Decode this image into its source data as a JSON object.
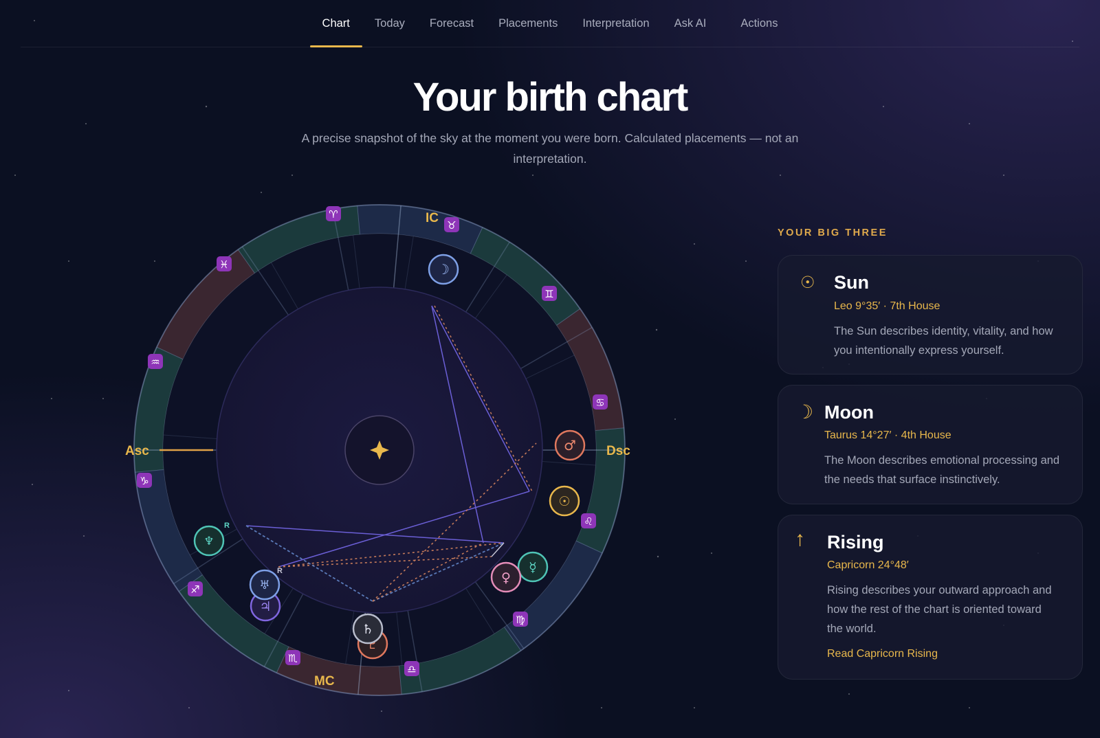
{
  "nav": {
    "tabs": [
      {
        "label": "Chart",
        "active": true
      },
      {
        "label": "Today"
      },
      {
        "label": "Forecast"
      },
      {
        "label": "Placements"
      },
      {
        "label": "Interpretation"
      },
      {
        "label": "Ask AI"
      },
      {
        "label": "Actions"
      }
    ]
  },
  "header": {
    "title": "Your birth chart",
    "subtitle": "A precise snapshot of the sky at the moment you were born. Calculated placements — not an interpretation."
  },
  "wheel": {
    "angles": {
      "asc": "Asc",
      "dsc": "Dsc",
      "mc": "MC",
      "ic": "IC"
    },
    "retrograde_mark": "R",
    "signs": [
      "♈",
      "♉",
      "♊",
      "♋",
      "♌",
      "♍",
      "♎",
      "♏",
      "♐",
      "♑",
      "♒",
      "♓"
    ],
    "planets": {
      "sun": "☉",
      "moon": "☽",
      "mercury": "☿",
      "venus": "♀",
      "mars": "♂",
      "jupiter": "♃",
      "saturn": "♄",
      "uranus": "♅",
      "neptune": "♆",
      "pluto": "♇"
    },
    "center_icon": "sparkle-icon"
  },
  "big_three": {
    "label": "YOUR BIG THREE",
    "sun": {
      "icon": "sun-icon",
      "glyph": "☉",
      "title": "Sun",
      "placement": "Leo 9°35′ · 7th House",
      "description": "The Sun describes identity, vitality, and how you intentionally express yourself."
    },
    "moon": {
      "icon": "moon-icon",
      "glyph": "☽",
      "title": "Moon",
      "placement": "Taurus 14°27′ · 4th House",
      "description": "The Moon describes emotional processing and the needs that surface instinctively."
    },
    "rising": {
      "icon": "arrow-up-icon",
      "glyph": "↑",
      "title": "Rising",
      "placement": "Capricorn 24°48′",
      "description": "Rising describes your outward approach and how the rest of the chart is oriented toward the world.",
      "link": "Read Capricorn Rising"
    }
  },
  "colors": {
    "accent": "#e9b84c",
    "background": "#0b1022",
    "sign_badge": "#8e35b8",
    "fire_sector": "#3a2630",
    "earth_sector": "#1b3a3c",
    "air_sector": "#1d2a48",
    "water_sector": "#1b3a3c"
  }
}
